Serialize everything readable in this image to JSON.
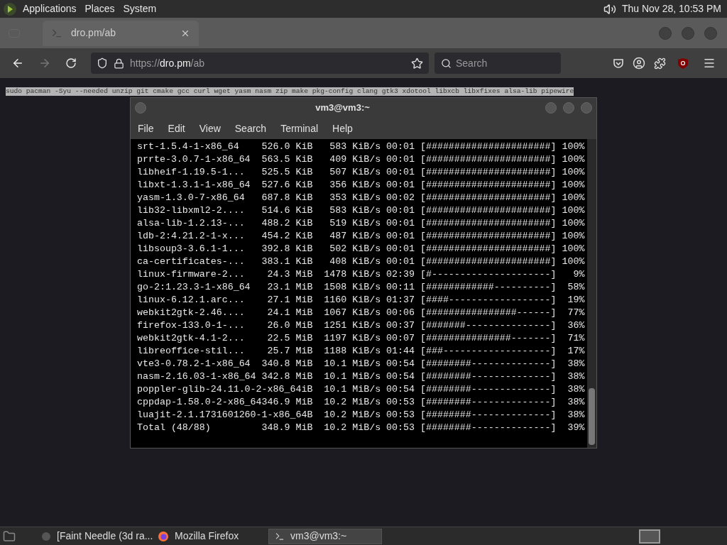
{
  "top_panel": {
    "menus": [
      "Applications",
      "Places",
      "System"
    ],
    "clock": "Thu Nov 28, 10:53 PM"
  },
  "browser": {
    "tabs": [
      {
        "label": "dro.pm/ab",
        "selected": true
      }
    ],
    "nav": {
      "forward_disabled": true,
      "url": {
        "scheme": "https://",
        "host": "dro.pm",
        "path": "/ab"
      },
      "search": {
        "placeholder": "Search"
      }
    },
    "page": {
      "selected_text": "sudo pacman -Syu --needed unzip git cmake gcc curl wget yasm nasm zip make pkg-config clang gtk3 xdotool libxcb libxfixes alsa-lib pipewire"
    }
  },
  "terminal": {
    "title": "vm3@vm3:~",
    "menu": [
      "File",
      "Edit",
      "View",
      "Search",
      "Terminal",
      "Help"
    ],
    "lines": [
      "srt-1.5.4-1-x86_64    526.0 KiB   583 KiB/s 00:01 [######################] 100%",
      "prrte-3.0.7-1-x86_64  563.5 KiB   409 KiB/s 00:01 [######################] 100%",
      "libheif-1.19.5-1...   525.5 KiB   507 KiB/s 00:01 [######################] 100%",
      "libxt-1.3.1-1-x86_64  527.6 KiB   356 KiB/s 00:01 [######################] 100%",
      "yasm-1.3.0-7-x86_64   687.8 KiB   353 KiB/s 00:02 [######################] 100%",
      "lib32-libxml2-2....   514.6 KiB   583 KiB/s 00:01 [######################] 100%",
      "alsa-lib-1.2.13-...   488.2 KiB   519 KiB/s 00:01 [######################] 100%",
      "ldb-2:4.21.2-1-x...   454.2 KiB   487 KiB/s 00:01 [######################] 100%",
      "libsoup3-3.6.1-1...   392.8 KiB   502 KiB/s 00:01 [######################] 100%",
      "ca-certificates-...   383.1 KiB   408 KiB/s 00:01 [######################] 100%",
      "linux-firmware-2...    24.3 MiB  1478 KiB/s 02:39 [#---------------------]   9%",
      "go-2:1.23.3-1-x86_64   23.1 MiB  1508 KiB/s 00:11 [############----------]  58%",
      "linux-6.12.1.arc...    27.1 MiB  1160 KiB/s 01:37 [####------------------]  19%",
      "webkit2gtk-2.46....    24.1 MiB  1067 KiB/s 00:06 [################------]  77%",
      "firefox-133.0-1-...    26.0 MiB  1251 KiB/s 00:37 [#######---------------]  36%",
      "webkit2gtk-4.1-2...    22.5 MiB  1197 KiB/s 00:07 [###############-------]  71%",
      "libreoffice-stil...    25.7 MiB  1188 KiB/s 01:44 [###-------------------]  17%",
      "vte3-0.78.2-1-x86_64  340.8 MiB  10.1 MiB/s 00:54 [########--------------]  38%",
      "nasm-2.16.03-1-x86_64 342.8 MiB  10.1 MiB/s 00:54 [########--------------]  38%",
      "poppler-glib-24.11.0-2-x86_64iB  10.1 MiB/s 00:54 [########--------------]  38%",
      "cppdap-1.58.0-2-x86_64346.9 MiB  10.2 MiB/s 00:53 [########--------------]  38%",
      "luajit-2.1.1731601260-1-x86_64B  10.2 MiB/s 00:53 [########--------------]  38%",
      "Total (48/88)         348.9 MiB  10.2 MiB/s 00:53 [########--------------]  39%"
    ]
  },
  "taskbar": {
    "items": [
      {
        "kind": "generic",
        "label": "[Faint Needle (3d ra...",
        "selected": false
      },
      {
        "kind": "firefox",
        "label": "Mozilla Firefox",
        "selected": false
      },
      {
        "kind": "terminal",
        "label": "vm3@vm3:~",
        "selected": true
      }
    ]
  }
}
